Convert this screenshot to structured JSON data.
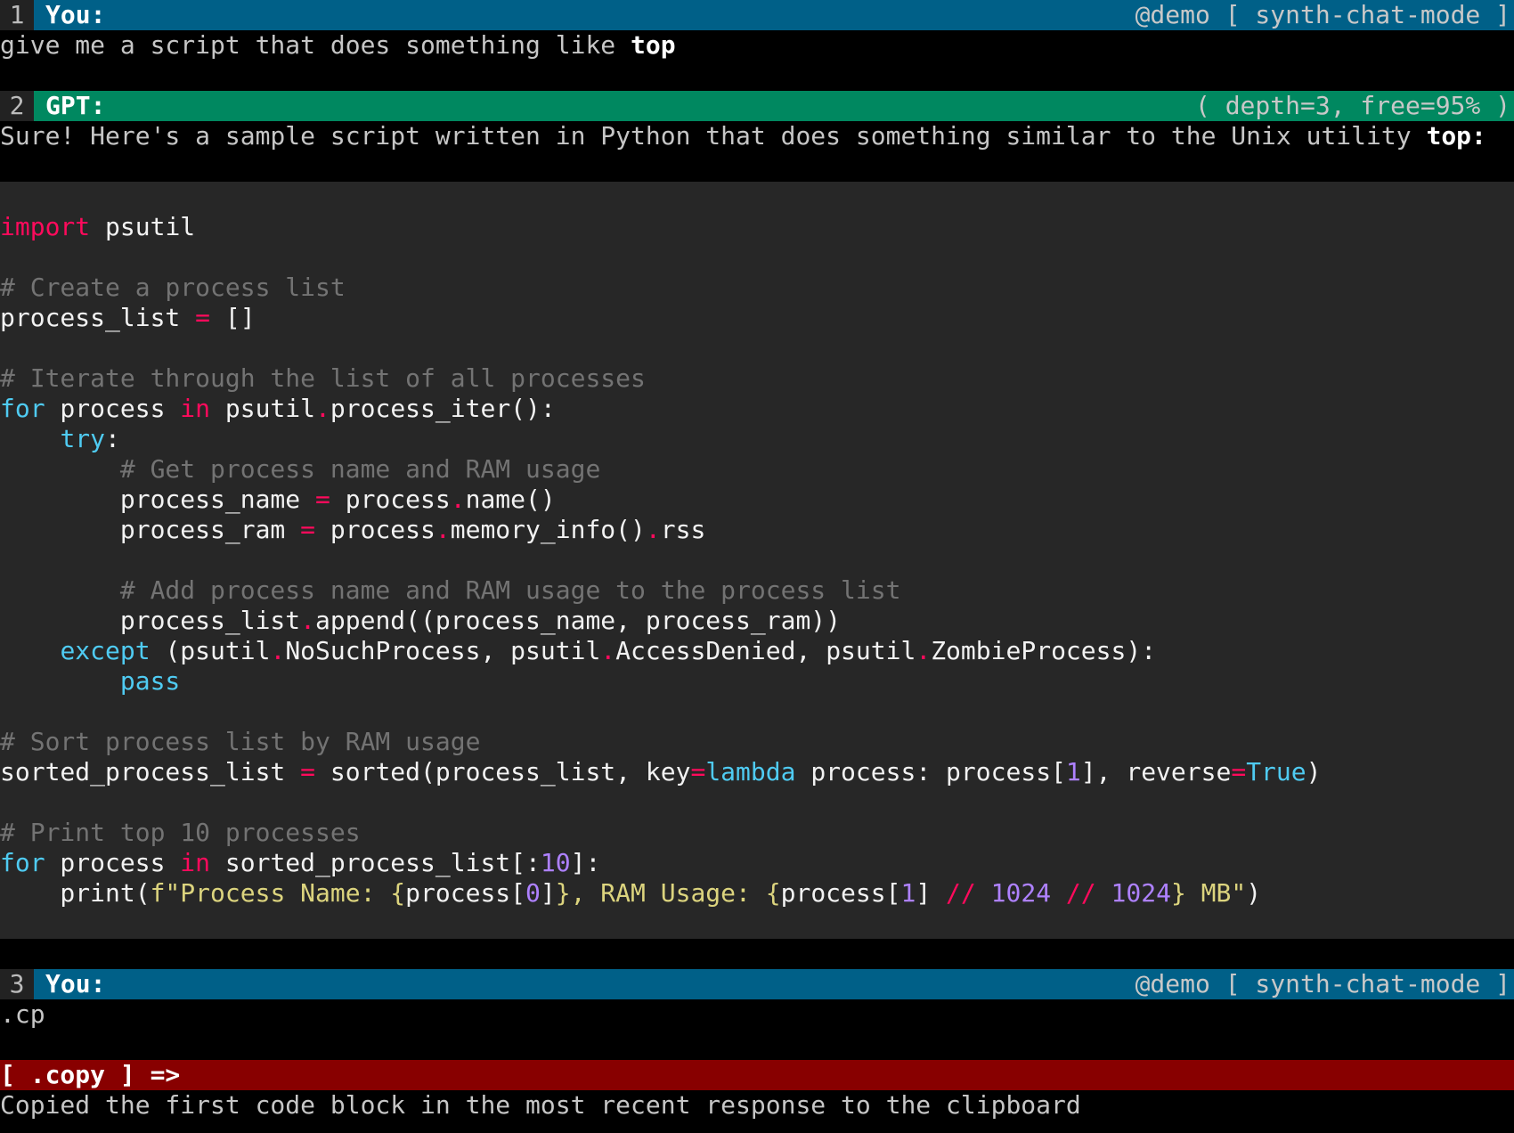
{
  "messages": [
    {
      "number": "1",
      "role": "You:",
      "meta": "@demo [ synth-chat-mode ]",
      "text_before": "give me a script that does something like ",
      "text_emph": "top"
    },
    {
      "number": "2",
      "role": "GPT:",
      "meta": "( depth=3, free=95% )",
      "text_before": "Sure! Here's a sample script written in Python that does something similar to the Unix utility ",
      "text_emph": "top:"
    },
    {
      "number": "3",
      "role": "You:",
      "meta": "@demo [ synth-chat-mode ]",
      "text_before": ".cp",
      "text_emph": ""
    }
  ],
  "command": {
    "label": "[ .copy ] =>",
    "result": "Copied the first code block in the most recent response to the clipboard"
  },
  "colors": {
    "you_header": "#006088",
    "gpt_header": "#008860",
    "command_bar": "#880000",
    "code_bg": "#272727"
  },
  "code_lines": [
    [],
    [
      [
        "kw",
        "import"
      ],
      [
        "n",
        " psutil"
      ]
    ],
    [],
    [
      [
        "com",
        "# Create a process list"
      ]
    ],
    [
      [
        "n",
        "process_list "
      ],
      [
        "op",
        "="
      ],
      [
        "n",
        " []"
      ]
    ],
    [],
    [
      [
        "com",
        "# Iterate through the list of all processes"
      ]
    ],
    [
      [
        "bi",
        "for"
      ],
      [
        "n",
        " process "
      ],
      [
        "kw",
        "in"
      ],
      [
        "n",
        " psutil"
      ],
      [
        "op",
        "."
      ],
      [
        "n",
        "process_iter():"
      ]
    ],
    [
      [
        "n",
        "    "
      ],
      [
        "bi",
        "try"
      ],
      [
        "n",
        ":"
      ]
    ],
    [
      [
        "n",
        "        "
      ],
      [
        "com",
        "# Get process name and RAM usage"
      ]
    ],
    [
      [
        "n",
        "        process_name "
      ],
      [
        "op",
        "="
      ],
      [
        "n",
        " process"
      ],
      [
        "op",
        "."
      ],
      [
        "n",
        "name()"
      ]
    ],
    [
      [
        "n",
        "        process_ram "
      ],
      [
        "op",
        "="
      ],
      [
        "n",
        " process"
      ],
      [
        "op",
        "."
      ],
      [
        "n",
        "memory_info()"
      ],
      [
        "op",
        "."
      ],
      [
        "n",
        "rss"
      ]
    ],
    [],
    [
      [
        "n",
        "        "
      ],
      [
        "com",
        "# Add process name and RAM usage to the process list"
      ]
    ],
    [
      [
        "n",
        "        process_list"
      ],
      [
        "op",
        "."
      ],
      [
        "n",
        "append((process_name, process_ram))"
      ]
    ],
    [
      [
        "n",
        "    "
      ],
      [
        "bi",
        "except"
      ],
      [
        "n",
        " (psutil"
      ],
      [
        "op",
        "."
      ],
      [
        "n",
        "NoSuchProcess, psutil"
      ],
      [
        "op",
        "."
      ],
      [
        "n",
        "AccessDenied, psutil"
      ],
      [
        "op",
        "."
      ],
      [
        "n",
        "ZombieProcess):"
      ]
    ],
    [
      [
        "n",
        "        "
      ],
      [
        "bi",
        "pass"
      ]
    ],
    [],
    [
      [
        "com",
        "# Sort process list by RAM usage"
      ]
    ],
    [
      [
        "n",
        "sorted_process_list "
      ],
      [
        "op",
        "="
      ],
      [
        "n",
        " sorted(process_list, key"
      ],
      [
        "op",
        "="
      ],
      [
        "bi",
        "lambda"
      ],
      [
        "n",
        " process: process["
      ],
      [
        "num",
        "1"
      ],
      [
        "n",
        "], reverse"
      ],
      [
        "op",
        "="
      ],
      [
        "bi",
        "True"
      ],
      [
        "n",
        ")"
      ]
    ],
    [],
    [
      [
        "com",
        "# Print top 10 processes"
      ]
    ],
    [
      [
        "bi",
        "for"
      ],
      [
        "n",
        " process "
      ],
      [
        "kw",
        "in"
      ],
      [
        "n",
        " sorted_process_list[:"
      ],
      [
        "num",
        "10"
      ],
      [
        "n",
        "]:"
      ]
    ],
    [
      [
        "n",
        "    print("
      ],
      [
        "str",
        "f\"Process Name: {"
      ],
      [
        "n",
        "process["
      ],
      [
        "num",
        "0"
      ],
      [
        "n",
        "]"
      ],
      [
        "str",
        "}, RAM Usage: {"
      ],
      [
        "n",
        "process["
      ],
      [
        "num",
        "1"
      ],
      [
        "n",
        "] "
      ],
      [
        "op",
        "//"
      ],
      [
        "n",
        " "
      ],
      [
        "num",
        "1024"
      ],
      [
        "n",
        " "
      ],
      [
        "op",
        "//"
      ],
      [
        "n",
        " "
      ],
      [
        "num",
        "1024"
      ],
      [
        "str",
        "} MB\""
      ],
      [
        "n",
        ")"
      ]
    ],
    []
  ]
}
